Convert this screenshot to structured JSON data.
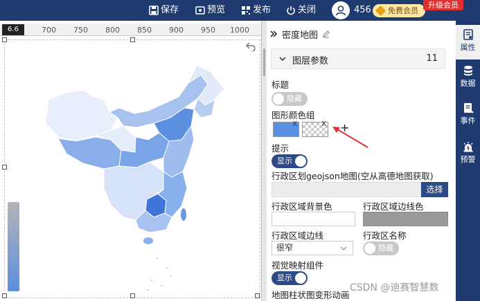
{
  "topbar": {
    "save": "保存",
    "preview": "预览",
    "publish": "发布",
    "close": "关闭",
    "user_id": "456",
    "vip_label": "免费会员",
    "upgrade_label": "升级会员"
  },
  "ruler": {
    "zoom": "6.6",
    "ticks": [
      "700",
      "750",
      "800",
      "850",
      "900",
      "950",
      "1000"
    ]
  },
  "visual_map": {
    "gradient_colors": [
      "#b4b4b4",
      "#5b8fe0"
    ]
  },
  "panel": {
    "title": "密度地图",
    "section": {
      "title": "图层参数",
      "count": "11"
    },
    "title_label": "标题",
    "title_toggle": "隐藏",
    "color_group_label": "图形颜色组",
    "color_swatches": [
      "#5b8fe0",
      "transparent"
    ],
    "swatch_remove": "X",
    "add_symbol": "+",
    "tooltip_label": "提示",
    "tooltip_toggle": "显示",
    "geojson_label": "行政区划geojson地图(空从高德地图获取)",
    "geojson_value": "",
    "select_button": "选择",
    "region_bg_label": "行政区域背景色",
    "region_border_color_label": "行政区域边线色",
    "region_bg_color": "#ffffff",
    "region_border_color": "#9a9a9a",
    "region_border_label": "行政区域边线",
    "region_border_value": "很窄",
    "region_name_label": "行政区名称",
    "region_name_toggle": "隐藏",
    "visual_map_label": "视觉映射组件",
    "visual_map_toggle": "显示",
    "animation_label": "地图柱状图变形动画"
  },
  "sidebar": {
    "items": [
      "属性",
      "数据",
      "事件",
      "预警"
    ]
  },
  "watermark": "CSDN @迪赛智慧数",
  "colors": {
    "navy": "#1f3a6e",
    "accent_blue": "#5b8fe0",
    "upgrade_red": "#e02f2f"
  }
}
